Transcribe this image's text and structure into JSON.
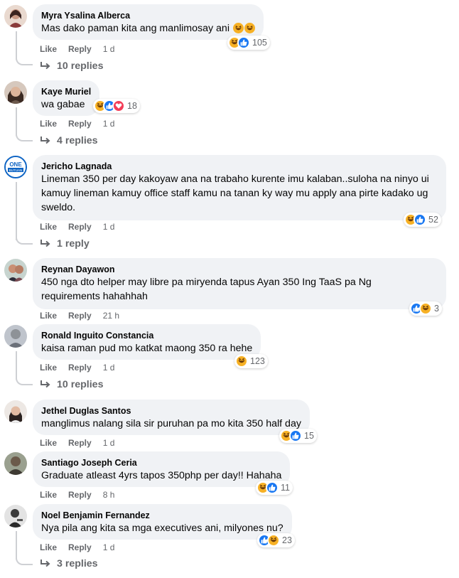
{
  "labels": {
    "like": "Like",
    "reply": "Reply"
  },
  "comments": [
    {
      "author": "Myra Ysalina Alberca",
      "text": "Mas dako paman kita ang manlimosay ani",
      "time": "1 d",
      "reaction_count": "105",
      "reactions": [
        "haha-icon",
        "like-icon"
      ],
      "replies": "10 replies",
      "text_emojis": [
        "haha-icon",
        "haha-icon"
      ]
    },
    {
      "author": "Kaye Muriel",
      "text": "wa gabae",
      "time": "1 d",
      "reaction_count": "18",
      "reactions": [
        "haha-icon",
        "like-icon",
        "love-icon"
      ],
      "replies": "4 replies"
    },
    {
      "author": "Jericho Lagnada",
      "text": "Lineman 350 per day kakoyaw ana na trabaho kurente imu kalaban..suloha na ninyo ui kamuy lineman kamuy office staff kamu na tanan ky way mu apply ana pirte kadako ug sweldo.",
      "time": "1 d",
      "reaction_count": "52",
      "reactions": [
        "haha-icon",
        "like-icon"
      ],
      "replies": "1 reply",
      "avatar_text": "ONE BUTUAN"
    },
    {
      "author": "Reynan Dayawon",
      "text": "450 nga dto helper may libre pa miryenda tapus Ayan 350 Ing TaaS pa Ng requirements hahahhah",
      "time": "21 h",
      "reaction_count": "3",
      "reactions": [
        "like-icon",
        "haha-icon"
      ]
    },
    {
      "author": "Ronald Inguito Constancia",
      "text": "kaisa raman pud mo katkat maong 350 ra hehe",
      "time": "1 d",
      "reaction_count": "123",
      "reactions": [
        "haha-icon"
      ],
      "replies": "10 replies"
    },
    {
      "author": "Jethel Duglas Santos",
      "text": "manglimus nalang sila sir puruhan pa mo kita 350 half day",
      "time": "1 d",
      "reaction_count": "15",
      "reactions": [
        "haha-icon",
        "like-icon"
      ]
    },
    {
      "author": "Santiago Joseph Ceria",
      "text": "Graduate atleast 4yrs tapos 350php per day!! Hahaha",
      "time": "8 h",
      "reaction_count": "11",
      "reactions": [
        "haha-icon",
        "like-icon"
      ]
    },
    {
      "author": "Noel Benjamin Fernandez",
      "text": "Nya pila ang kita sa mga executives ani, milyones nu?",
      "time": "1 d",
      "reaction_count": "23",
      "reactions": [
        "like-icon",
        "haha-icon"
      ],
      "replies": "3 replies"
    }
  ],
  "colors": {
    "bubble": "#f0f2f5",
    "like": "#1877f2",
    "haha": "#f7b125",
    "love": "#f33e58",
    "muted": "#65676b"
  }
}
